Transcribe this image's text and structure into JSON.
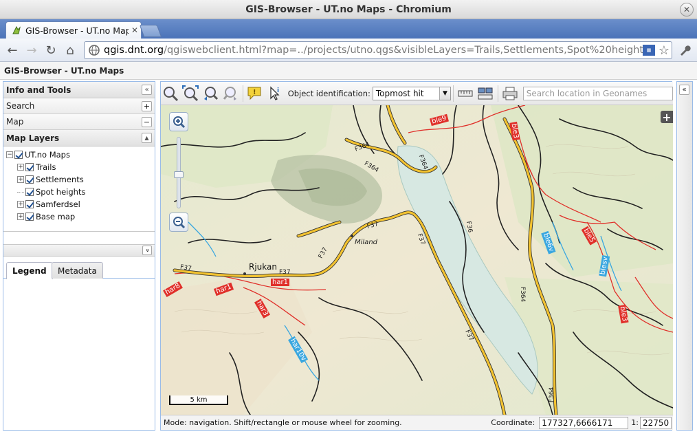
{
  "window": {
    "title": "GIS-Browser - UT.no Maps - Chromium",
    "close_glyph": "✕"
  },
  "tab": {
    "title": "GIS-Browser - UT.no Maps",
    "close_glyph": "✕"
  },
  "toolbar": {
    "back_glyph": "←",
    "forward_glyph": "→",
    "reload_glyph": "↻",
    "home_glyph": "⌂",
    "url_host": "qgis.dnt.org",
    "url_rest": "/qgiswebclient.html?map=../projects/utno.qgs&visibleLayers=Trails,Settlements,Spot%20heights,Sa",
    "star_glyph": "☆",
    "wrench_glyph": "🔧"
  },
  "app": {
    "header": "GIS-Browser - UT.no Maps"
  },
  "left_panel": {
    "title": "Info and Tools",
    "collapse_glyph": "«",
    "search": {
      "label": "Search",
      "toggle": "+"
    },
    "map": {
      "label": "Map",
      "toggle": "−"
    },
    "layers": {
      "title": "Map Layers",
      "toggle": "▲",
      "root": "UT.no Maps",
      "items": [
        {
          "label": "Trails",
          "expandable": "+"
        },
        {
          "label": "Settlements",
          "expandable": "+"
        },
        {
          "label": "Spot heights",
          "expandable": ""
        },
        {
          "label": "Samferdsel",
          "expandable": "+"
        },
        {
          "label": "Base map",
          "expandable": "+"
        }
      ]
    },
    "lower_toggle": "»",
    "tabs": {
      "legend": "Legend",
      "metadata": "Metadata"
    }
  },
  "map_toolbar": {
    "object_identification_label": "Object identification:",
    "object_identification_value": "Topmost hit",
    "search_placeholder": "Search location in Geonames"
  },
  "map": {
    "zoom_in": "+",
    "zoom_out": "−",
    "layer_switcher": "+",
    "scale_bar": "5 km",
    "labels": {
      "rjukan": "Rjukan",
      "miland": "Miland",
      "f37a": "F37",
      "f37b": "F37",
      "f37c": "F37",
      "f37d": "F37",
      "f37e": "F37",
      "f37f": "F37",
      "f364a": "F364",
      "f364b": "F364",
      "f364c": "F364",
      "f364d": "F364",
      "f364e": "F364",
      "ble9": "ble9",
      "ble3a": "ble3",
      "ble3b": "ble3",
      "ble5": "ble5",
      "ble6v": "ble6v",
      "blesv": "blesv",
      "har1a": "har1",
      "har1b": "har1",
      "har3": "har3",
      "har8": "har8",
      "har10v": "har10v",
      "f36": "F36"
    }
  },
  "status": {
    "mode": "Mode: navigation. Shift/rectangle or mouse wheel for zooming.",
    "coordinate_label": "Coordinate:",
    "coordinate_value": "177327,6666171",
    "scale_label": "1:",
    "scale_value": "22750"
  },
  "right_panel": {
    "collapse_glyph": "«"
  },
  "colors": {
    "tab_strip": "#4a72b8",
    "panel_border": "#99bbe8",
    "road": "#f2c230",
    "trail": "#e0302a",
    "water": "#d7e8e2"
  }
}
